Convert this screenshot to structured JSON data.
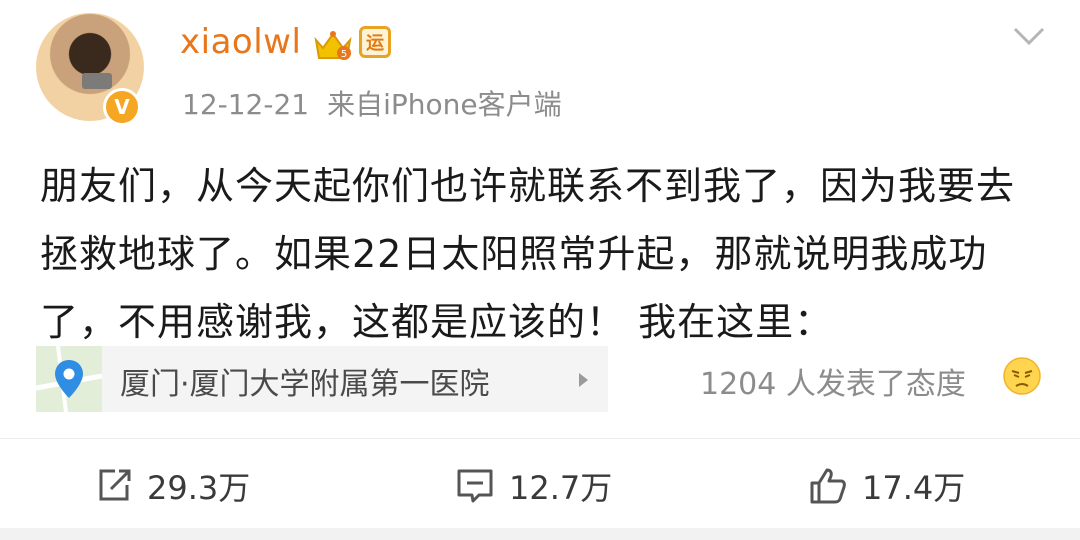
{
  "post": {
    "username": "xiaolwl",
    "vip_badge": "V",
    "yun_badge": "运",
    "date": "12-12-21",
    "source": "来自iPhone客户端",
    "text": "朋友们，从今天起你们也许就联系不到我了，因为我要去拯救地球了。如果22日太阳照常升起，那就说明我成功了，不用感谢我，这都是应该的！ 我在这里：",
    "location": "厦门·厦门大学附属第一医院",
    "reactions": "1204 人发表了态度"
  },
  "actions": {
    "repost": "29.3万",
    "comment": "12.7万",
    "like": "17.4万"
  },
  "colors": {
    "username": "#e8761a",
    "meta": "#8c8c8c",
    "vip": "#f5a623"
  },
  "icons": [
    "avatar",
    "vip-badge-icon",
    "crown-icon",
    "yun-badge-icon",
    "chevron-down-icon",
    "location-pin-icon",
    "emoji-icon",
    "repost-icon",
    "comment-icon",
    "like-icon"
  ]
}
